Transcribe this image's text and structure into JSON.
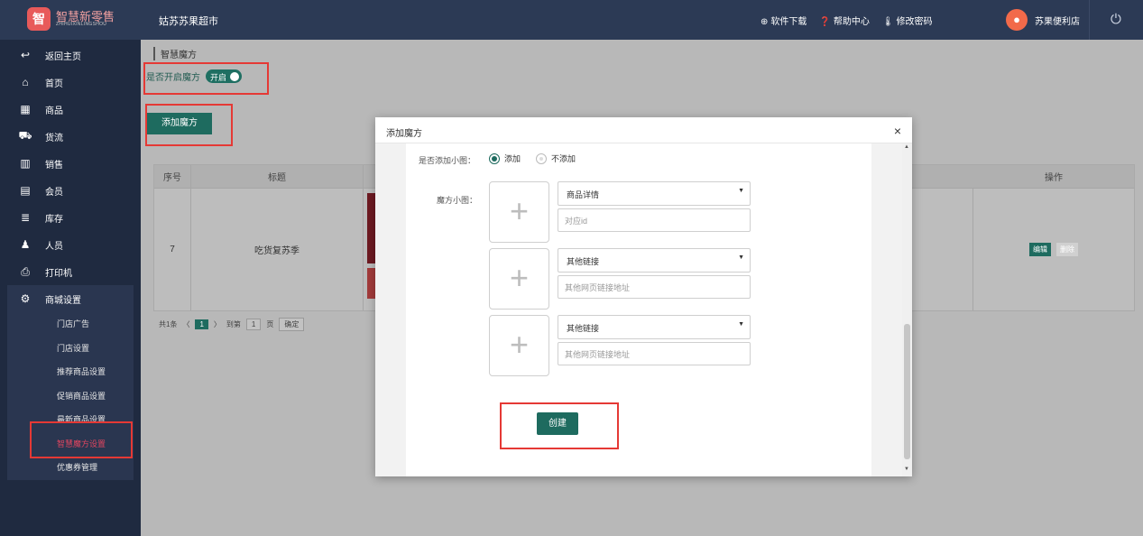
{
  "header": {
    "logo_mark": "智",
    "logo_title": "智慧新零售",
    "logo_sub": "ZHIHUIXINLINGSHOU",
    "store": "姑苏苏果超市",
    "links": [
      {
        "icon": "download-icon",
        "glyph": "⊕",
        "label": "软件下载"
      },
      {
        "icon": "help-icon",
        "glyph": "❓",
        "label": "帮助中心"
      },
      {
        "icon": "key-icon",
        "glyph": "🌡",
        "label": "修改密码"
      }
    ],
    "user_name": "苏果便利店",
    "power_glyph": "⏻"
  },
  "sidebar": {
    "items": [
      {
        "icon": "back-icon",
        "glyph": "↩",
        "label": "返回主页"
      },
      {
        "icon": "home-icon",
        "glyph": "⌂",
        "label": "首页"
      },
      {
        "icon": "grid-icon",
        "glyph": "▦",
        "label": "商品"
      },
      {
        "icon": "truck-icon",
        "glyph": "⛟",
        "label": "货流"
      },
      {
        "icon": "bar-chart-icon",
        "glyph": "▥",
        "label": "销售"
      },
      {
        "icon": "member-card-icon",
        "glyph": "▤",
        "label": "会员"
      },
      {
        "icon": "database-icon",
        "glyph": "≣",
        "label": "库存"
      },
      {
        "icon": "person-icon",
        "glyph": "♟",
        "label": "人员"
      },
      {
        "icon": "printer-icon",
        "glyph": "⎙",
        "label": "打印机"
      }
    ],
    "group": {
      "icon": "gear-icon",
      "glyph": "⚙",
      "label": "商城设置",
      "subitems": [
        "门店广告",
        "门店设置",
        "推荐商品设置",
        "促销商品设置",
        "最新商品设置",
        "智慧魔方设置",
        "优惠券管理"
      ],
      "active_index": 5
    }
  },
  "main": {
    "breadcrumb": "智慧魔方",
    "toggle_label": "是否开启魔方",
    "toggle_state": "开启",
    "add_button": "添加魔方",
    "table": {
      "headers": [
        "序号",
        "标题",
        "操作"
      ],
      "rows": [
        {
          "id": "7",
          "title": "吃货复苏季",
          "edit": "编辑",
          "delete": "删除"
        }
      ]
    },
    "pager": {
      "total": "共1条",
      "prev": "〈",
      "current": "1",
      "next": "〉",
      "goto": "到第",
      "page_value": "1",
      "page_unit": "页",
      "confirm": "确定"
    }
  },
  "modal": {
    "title": "添加魔方",
    "close": "×",
    "add_small_label": "是否添加小图：",
    "radio_add": "添加",
    "radio_no": "不添加",
    "small_label": "魔方小图：",
    "plus": "+",
    "entries": [
      {
        "select": "商品详情",
        "placeholder": "对应id"
      },
      {
        "select": "其他链接",
        "placeholder": "其他网页链接地址"
      },
      {
        "select": "其他链接",
        "placeholder": "其他网页链接地址"
      }
    ],
    "arrow": "▼",
    "create": "创建"
  }
}
